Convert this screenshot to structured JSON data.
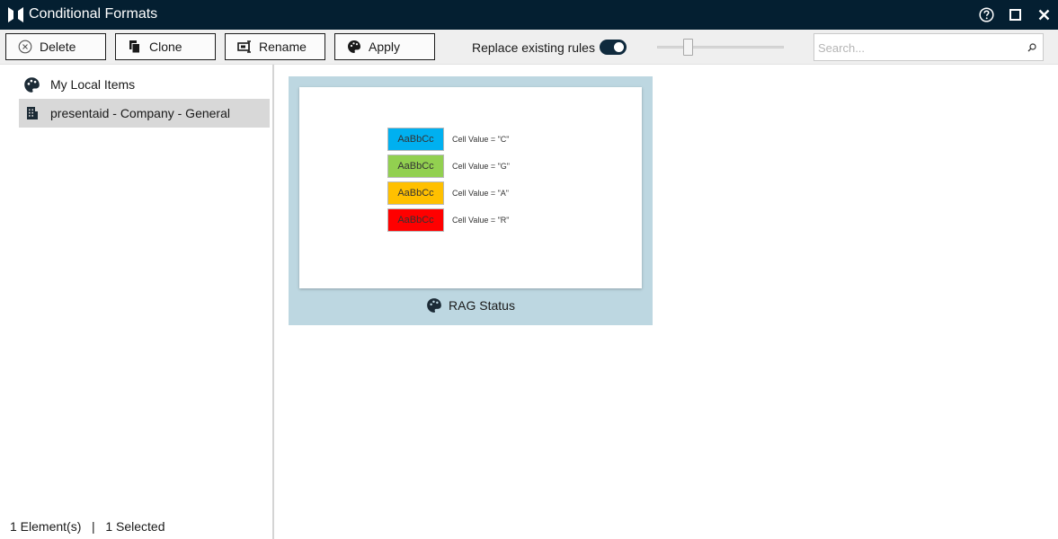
{
  "window": {
    "title": "Conditional Formats",
    "icons": {
      "logo": "app-logo-icon",
      "help": "help-icon",
      "maximize": "maximize-icon",
      "close": "close-icon"
    }
  },
  "toolbar": {
    "delete_label": "Delete",
    "clone_label": "Clone",
    "rename_label": "Rename",
    "apply_label": "Apply",
    "replace_label": "Replace existing rules",
    "replace_enabled": true,
    "zoom_level": 0.2,
    "search_placeholder": "Search...",
    "search_value": ""
  },
  "sidebar": {
    "items": [
      {
        "label": "My Local Items",
        "icon": "palette-icon",
        "selected": false
      },
      {
        "label": "presentaid - Company - General",
        "icon": "building-icon",
        "selected": true
      }
    ]
  },
  "status": {
    "elements": "1 Element(s)",
    "separator": "|",
    "selected": "1 Selected"
  },
  "gallery": {
    "items": [
      {
        "name": "RAG Status",
        "icon": "palette-icon",
        "rules": [
          {
            "sample": "AaBbCc",
            "condition": "Cell Value = \"C\"",
            "color": "#00b0f0"
          },
          {
            "sample": "AaBbCc",
            "condition": "Cell Value = \"G\"",
            "color": "#92d050"
          },
          {
            "sample": "AaBbCc",
            "condition": "Cell Value = \"A\"",
            "color": "#ffc000"
          },
          {
            "sample": "AaBbCc",
            "condition": "Cell Value = \"R\"",
            "color": "#ff0000"
          }
        ]
      }
    ]
  },
  "colors": {
    "titlebar": "#041f31",
    "accent": "#0f2a3d",
    "selection": "#bdd7e1",
    "tree_selection": "#d8d8d8"
  }
}
